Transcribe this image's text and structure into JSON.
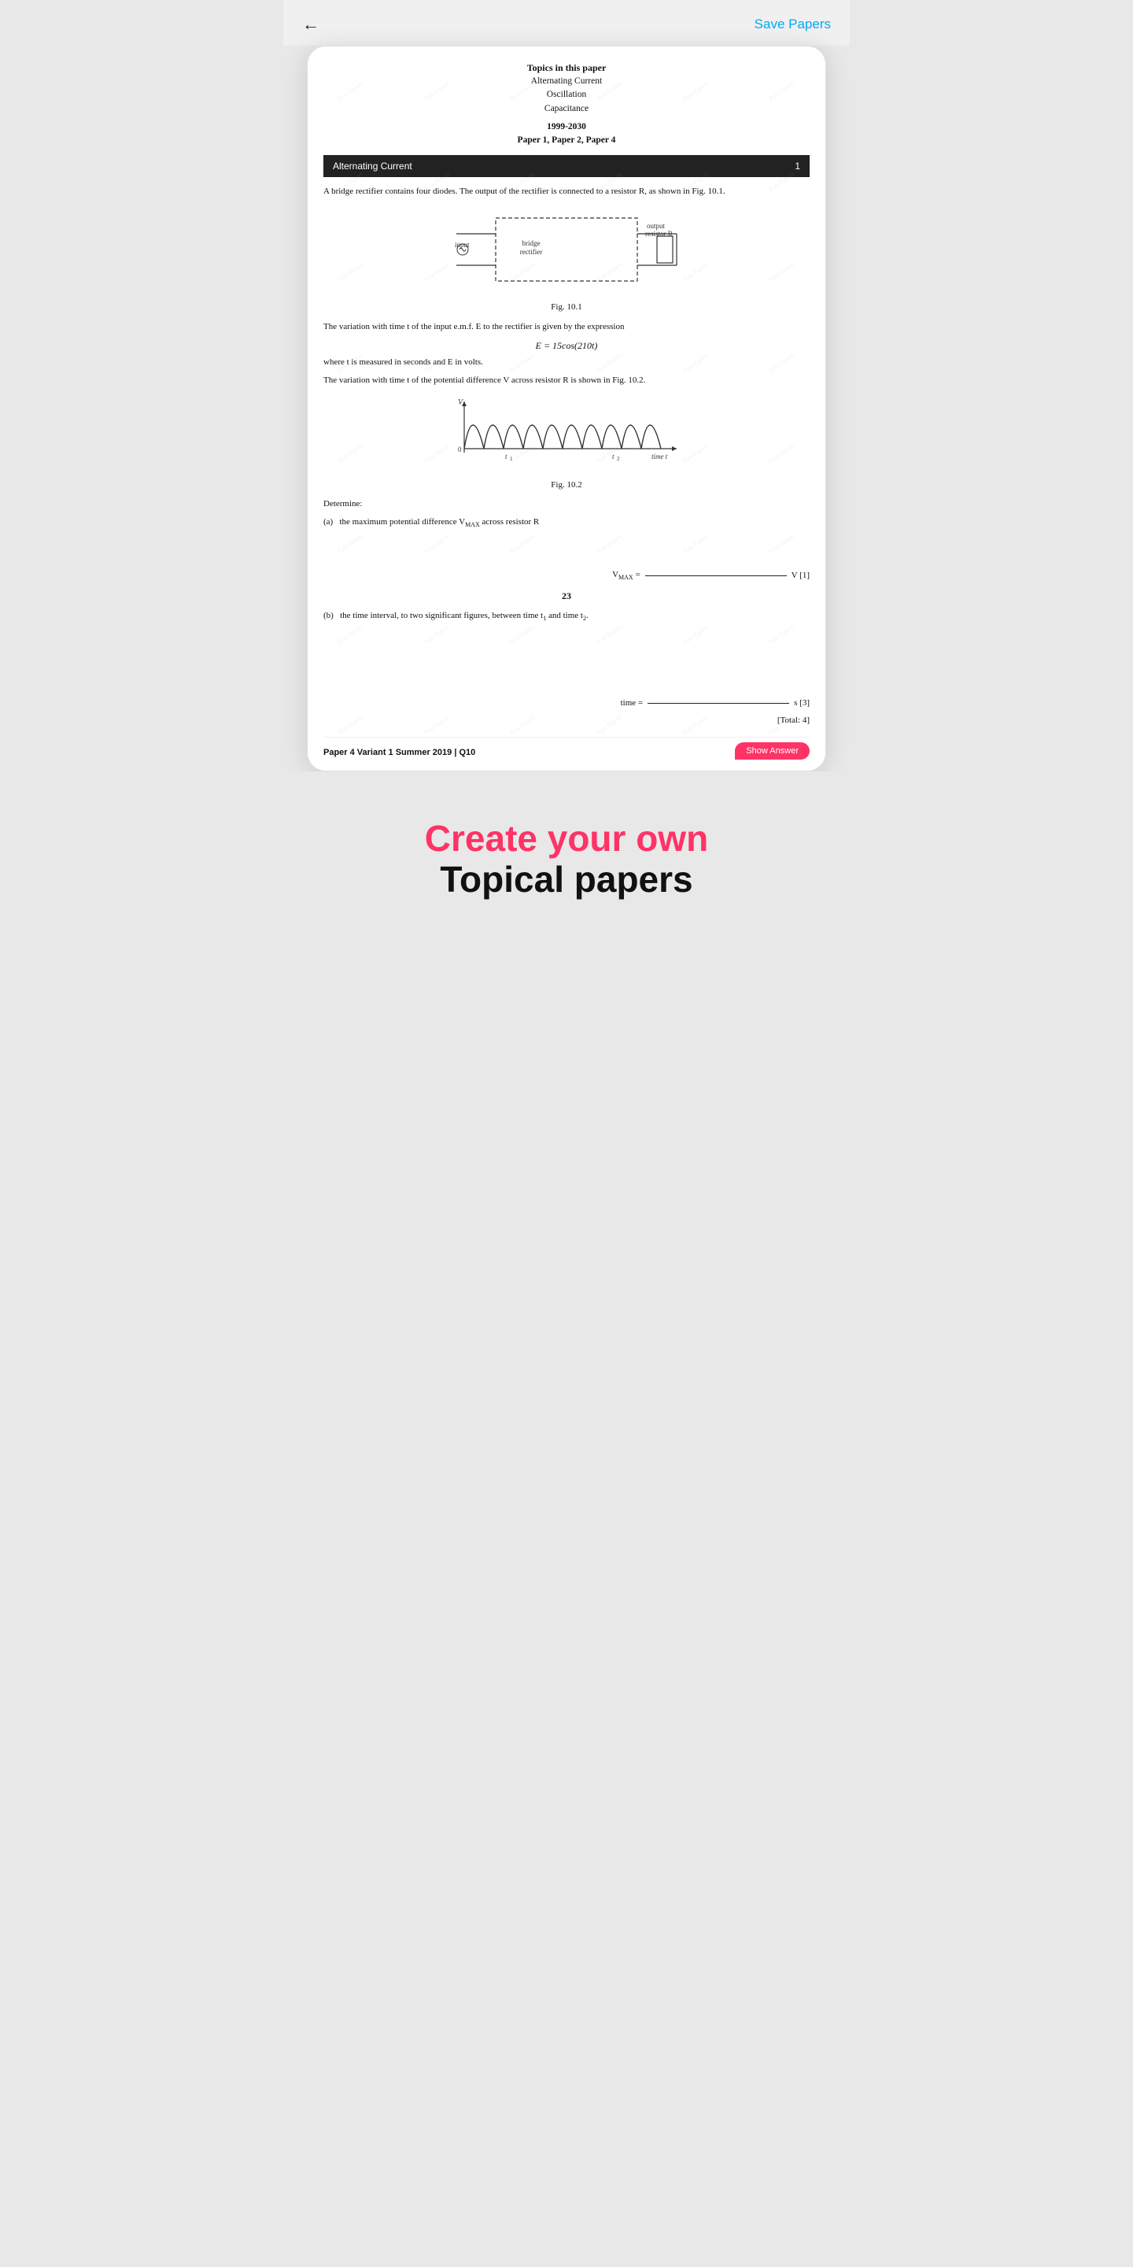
{
  "header": {
    "back_label": "←",
    "save_label": "Save Papers"
  },
  "paper": {
    "topics_title": "Topics in this paper",
    "topics": [
      "Alternating Current",
      "Oscillation",
      "Capacitance"
    ],
    "year_range": "1999-2030",
    "paper_list": "Paper 1, Paper 2, Paper 4",
    "section_name": "Alternating Current",
    "section_number": "1",
    "q_intro": "A bridge rectifier contains four diodes. The output of the rectifier is connected to a resistor R, as shown in Fig. 10.1.",
    "fig1_caption": "Fig. 10.1",
    "fig1_labels": {
      "input": "input",
      "bridge_rectifier": "bridge rectifier",
      "output_resistor": "output resistor R"
    },
    "q_variation": "The variation with time t of the input e.m.f. E to the rectifier is given by the expression",
    "formula": "E = 15cos(210t)",
    "q_where": "where t is measured in seconds and E in volts.",
    "q_variation2": "The variation with time t of the potential difference V across resistor R is shown in Fig. 10.2.",
    "fig2_caption": "Fig. 10.2",
    "fig2_labels": {
      "v_axis": "V",
      "zero": "0",
      "t1": "t₁",
      "t2": "t₂",
      "time_axis": "time t"
    },
    "determine_label": "Determine:",
    "q_a_label": "(a)",
    "q_a_text": "the maximum potential difference V",
    "q_a_sub": "MAX",
    "q_a_rest": " across resistor R",
    "answer_a_prefix": "V",
    "answer_a_sub": "MAX",
    "answer_a_eq": " = ",
    "answer_a_unit": "V [1]",
    "page_number": "23",
    "q_b_label": "(b)",
    "q_b_text": "the time interval, to two significant figures, between time t₁ and time t₂.",
    "answer_b_prefix": "time = ",
    "answer_b_unit": "s  [3]",
    "total_marks": "[Total: 4]",
    "footer_ref": "Paper 4 Variant 1 Summer 2019 | Q10",
    "show_answer_label": "Show Answer"
  },
  "promo": {
    "line1": "Create your own",
    "line2": "Topical papers"
  },
  "watermark": "Past Papers"
}
